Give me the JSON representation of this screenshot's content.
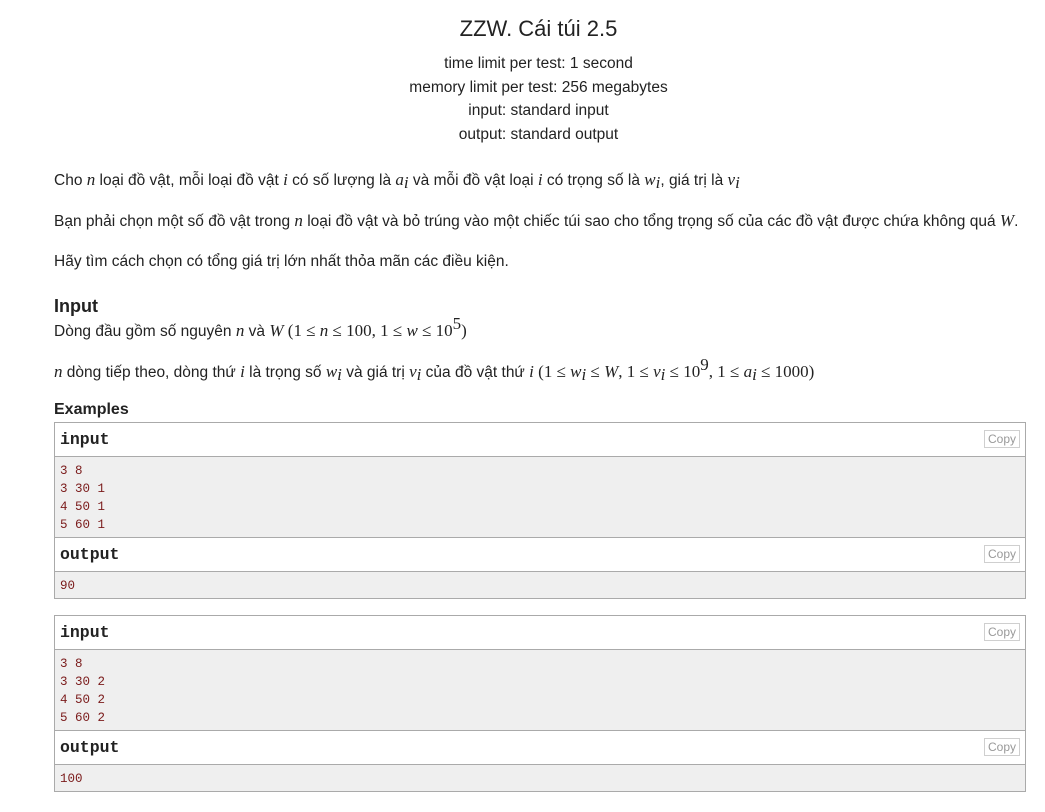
{
  "problem": {
    "title": "ZZW. Cái túi 2.5",
    "time_limit": "time limit per test: 1 second",
    "memory_limit": "memory limit per test: 256 megabytes",
    "input_file": "input: standard input",
    "output_file": "output: standard output"
  },
  "statement": {
    "p1": {
      "t1": "Cho ",
      "n": "n",
      "t2": " loại đồ vật, mỗi loại đồ vật ",
      "i1": "i",
      "t3": " có số lượng là ",
      "a": "a",
      "ai_sub": "i",
      "t4": " và mỗi đồ vật loại ",
      "i2": "i",
      "t5": " có trọng số là ",
      "w": "w",
      "wi_sub": "i",
      "t6": ", giá trị là ",
      "v": "v",
      "vi_sub": "i"
    },
    "p2": {
      "t1": "Bạn phải chọn một số đồ vật trong ",
      "n": "n",
      "t2": " loại đồ vật và bỏ trúng vào một chiếc túi sao cho tổng trọng số của các đồ vật được chứa không quá ",
      "W": "W",
      "t3": "."
    },
    "p3": "Hãy tìm cách chọn có tổng giá trị lớn nhất thỏa mãn các điều kiện."
  },
  "input_section": {
    "heading": "Input",
    "line1": {
      "t1": "Dòng đầu gồm số nguyên ",
      "n": "n",
      "t2": " và ",
      "W": "W",
      "c1": "(1 ≤ ",
      "n2": "n",
      "c2": " ≤ 100, 1 ≤ ",
      "w": "w",
      "c3": " ≤ 10",
      "exp": "5",
      "c4": ")"
    },
    "line2": {
      "n": "n",
      "t1": " dòng tiếp theo, dòng thứ ",
      "i": "i",
      "t2": " là trọng số ",
      "w": "w",
      "w_sub": "i",
      "t3": " và giá trị ",
      "v": "v",
      "v_sub": "i",
      "t4": " của đồ vật thứ ",
      "i2": "i",
      "c1": "(1 ≤ ",
      "w2": "w",
      "w2_sub": "i",
      "c2": " ≤ ",
      "W": "W",
      "c3": ", 1 ≤ ",
      "v2": "v",
      "v2_sub": "i",
      "c4": " ≤ 10",
      "exp": "9",
      "c5": ", 1 ≤ ",
      "a": "a",
      "a_sub": "i",
      "c6": " ≤ 1000)"
    }
  },
  "examples": {
    "heading": "Examples",
    "input_label": "input",
    "output_label": "output",
    "copy_label": "Copy",
    "items": [
      {
        "input": [
          "3 8",
          "3 30 1",
          "4 50 1",
          "5 60 1"
        ],
        "output": [
          "90"
        ]
      },
      {
        "input": [
          "3 8",
          "3 30 2",
          "4 50 2",
          "5 60 2"
        ],
        "output": [
          "100"
        ]
      }
    ]
  }
}
